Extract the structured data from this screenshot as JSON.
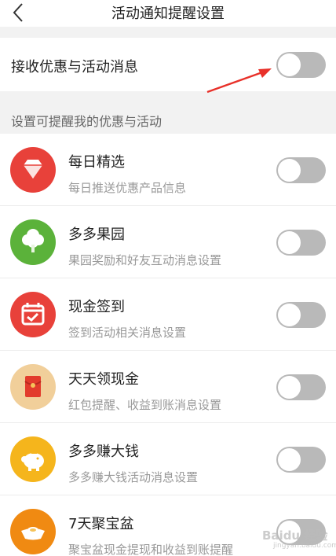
{
  "header": {
    "title": "活动通知提醒设置"
  },
  "master": {
    "label": "接收优惠与活动消息",
    "enabled": false
  },
  "section": {
    "label": "设置可提醒我的优惠与活动"
  },
  "items": [
    {
      "name": "每日精选",
      "desc": "每日推送优惠产品信息",
      "icon": "diamond-icon",
      "color": "#e8413a",
      "enabled": false
    },
    {
      "name": "多多果园",
      "desc": "果园奖励和好友互动消息设置",
      "icon": "tree-icon",
      "color": "#5bb23a",
      "enabled": false
    },
    {
      "name": "现金签到",
      "desc": "签到活动相关消息设置",
      "icon": "calendar-check-icon",
      "color": "#e8413a",
      "enabled": false
    },
    {
      "name": "天天领现金",
      "desc": "红包提醒、收益到账消息设置",
      "icon": "red-envelope-icon",
      "color": "#f1cf9a",
      "enabled": false
    },
    {
      "name": "多多赚大钱",
      "desc": "多多赚大钱活动消息设置",
      "icon": "piggy-bank-icon",
      "color": "#f5b51c",
      "enabled": false
    },
    {
      "name": "7天聚宝盆",
      "desc": "聚宝盆现金提现和收益到账提醒",
      "icon": "gold-ingot-icon",
      "color": "#f08a12",
      "enabled": false
    }
  ],
  "annotation": {
    "arrow_color": "#e8312a"
  },
  "watermark": {
    "text": "Baidu 经验",
    "sub": "jingyan.baidu.com"
  }
}
